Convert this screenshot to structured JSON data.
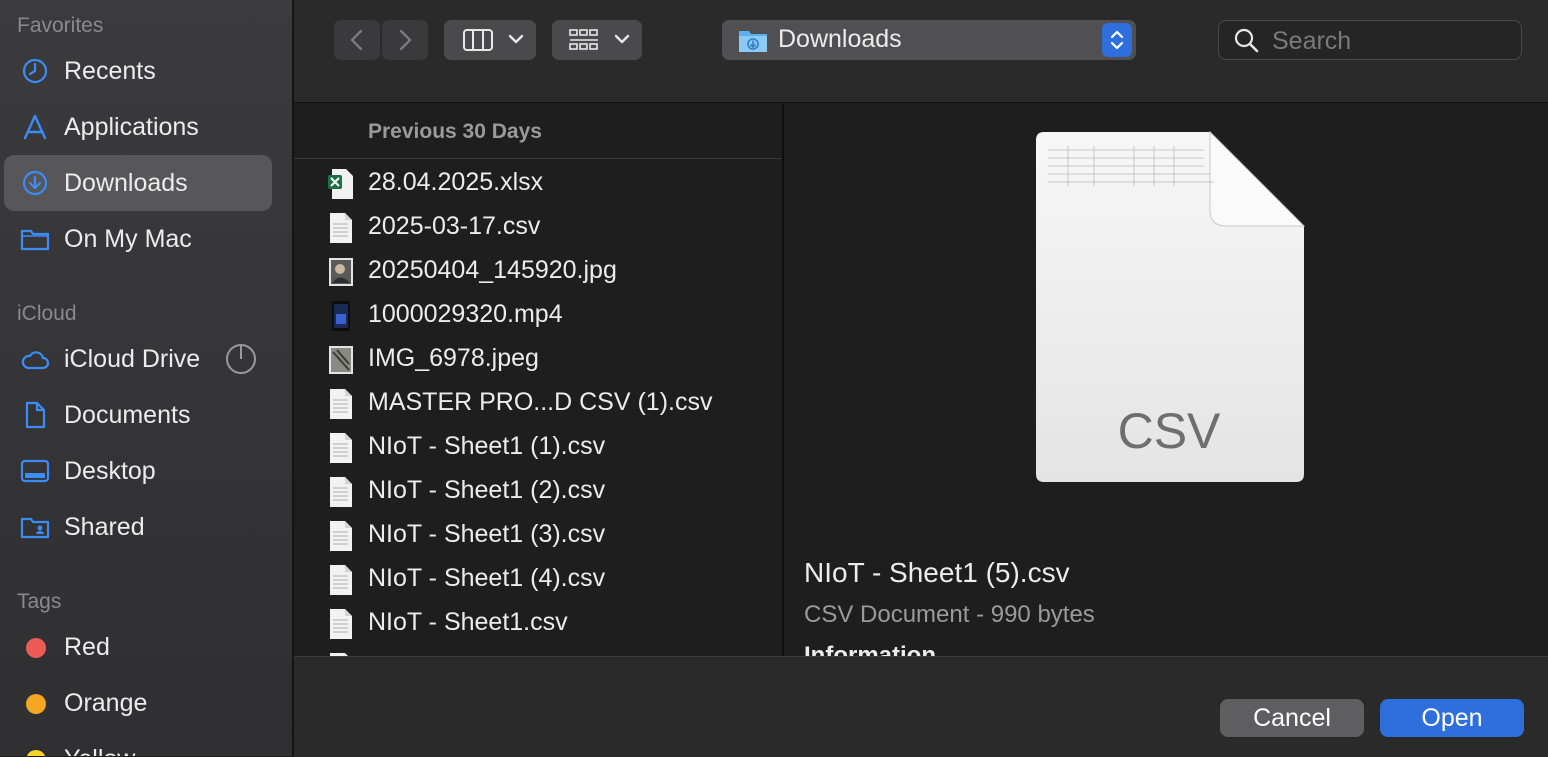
{
  "sidebar": {
    "favorites_label": "Favorites",
    "favorites": [
      {
        "label": "Recents",
        "icon": "clock-icon"
      },
      {
        "label": "Applications",
        "icon": "applications-icon"
      },
      {
        "label": "Downloads",
        "icon": "downloads-icon",
        "selected": true
      },
      {
        "label": "On My Mac",
        "icon": "folder-icon"
      }
    ],
    "icloud_label": "iCloud",
    "icloud": [
      {
        "label": "iCloud Drive",
        "icon": "cloud-icon"
      },
      {
        "label": "Documents",
        "icon": "document-icon"
      },
      {
        "label": "Desktop",
        "icon": "desktop-icon"
      },
      {
        "label": "Shared",
        "icon": "shared-folder-icon"
      }
    ],
    "tags_label": "Tags",
    "tags": [
      {
        "label": "Red",
        "color": "#ec5b57"
      },
      {
        "label": "Orange",
        "color": "#f5a623"
      },
      {
        "label": "Yellow",
        "color": "#f8d32a"
      }
    ]
  },
  "toolbar": {
    "location": "Downloads",
    "search_placeholder": "Search"
  },
  "file_list": {
    "section_header": "Previous 30 Days",
    "files": [
      {
        "name": "28.04.2025.xlsx",
        "type": "xlsx"
      },
      {
        "name": "2025-03-17.csv",
        "type": "csv"
      },
      {
        "name": "20250404_145920.jpg",
        "type": "jpg"
      },
      {
        "name": "1000029320.mp4",
        "type": "mp4"
      },
      {
        "name": "IMG_6978.jpeg",
        "type": "jpeg"
      },
      {
        "name": "MASTER PRO...D CSV (1).csv",
        "type": "csv"
      },
      {
        "name": "NIoT - Sheet1 (1).csv",
        "type": "csv"
      },
      {
        "name": "NIoT - Sheet1 (2).csv",
        "type": "csv"
      },
      {
        "name": "NIoT - Sheet1 (3).csv",
        "type": "csv"
      },
      {
        "name": "NIoT - Sheet1 (4).csv",
        "type": "csv"
      },
      {
        "name": "NIoT - Sheet1.csv",
        "type": "csv"
      }
    ]
  },
  "preview": {
    "file_badge": "CSV",
    "file_name": "NIoT - Sheet1 (5).csv",
    "file_kind": "CSV Document - 990 bytes",
    "info_label": "Information"
  },
  "buttons": {
    "cancel": "Cancel",
    "open": "Open"
  },
  "colors": {
    "accent": "#2f6fdc",
    "sidebar_icon": "#3b8df5"
  }
}
